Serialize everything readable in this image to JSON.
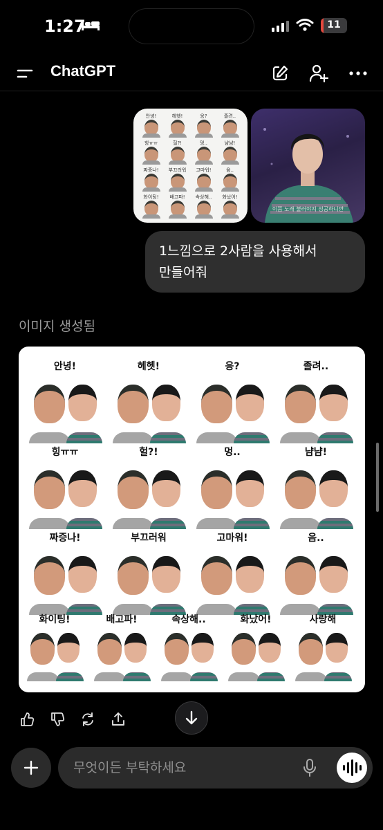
{
  "status_bar": {
    "time": "1:27",
    "battery_level": "11",
    "battery_fraction": 0.11,
    "icons": [
      "bed-icon",
      "signal-icon",
      "wifi-icon",
      "battery-icon"
    ]
  },
  "nav": {
    "title": "ChatGPT",
    "icons": [
      "menu-icon",
      "new-chat-icon",
      "add-person-icon",
      "more-icon"
    ]
  },
  "user_message": {
    "attachment_1_stickers": [
      "안녕!",
      "헤헷!",
      "응?",
      "졸려..",
      "힝ㅠㅠ",
      "헐?!",
      "멍..",
      "냠냠!",
      "짜증나!",
      "부끄러워",
      "고마워!",
      "음..",
      "화이팅!",
      "배고파!",
      "속상해..",
      "화났어!"
    ],
    "attachment_2_caption": "이쯤 노래 불러야지 성공하니깐",
    "text_line1": "1느낌으로 2사람을 사용해서",
    "text_line2": "만들어줘"
  },
  "assistant": {
    "label": "이미지 생성됨",
    "stickers": [
      "안녕!",
      "헤헷!",
      "응?",
      "졸려..",
      "힝ㅠㅠ",
      "헐?!",
      "멍..",
      "냠냠!",
      "짜증나!",
      "부끄러워",
      "고마워!",
      "음..",
      "화이팅!",
      "배고파!",
      "속상해..",
      "화났어!",
      "사랑해"
    ]
  },
  "actions": [
    "thumbs-up-icon",
    "thumbs-down-icon",
    "regenerate-icon",
    "share-icon"
  ],
  "composer": {
    "placeholder": "무엇이든 부탁하세요"
  },
  "colors": {
    "background": "#000000",
    "bubble": "#2f2f2f",
    "composer": "#2b2b2b",
    "battery_red": "#e5483d",
    "muted_text": "#9b9b9b"
  }
}
